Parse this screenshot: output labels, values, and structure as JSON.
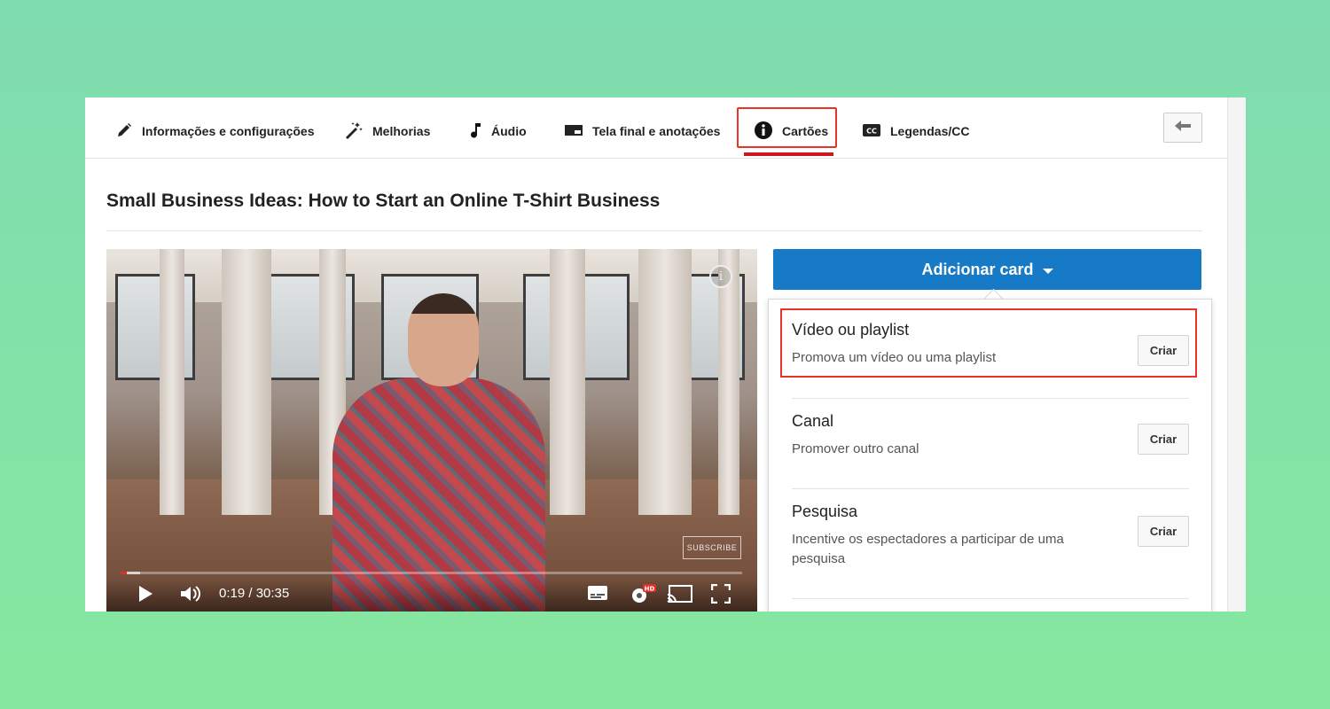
{
  "tabs": [
    {
      "label": "Informações e configurações",
      "icon": "pencil-icon"
    },
    {
      "label": "Melhorias",
      "icon": "magic-wand-icon"
    },
    {
      "label": "Áudio",
      "icon": "music-note-icon"
    },
    {
      "label": "Tela final e anotações",
      "icon": "end-screen-icon"
    },
    {
      "label": "Cartões",
      "icon": "info-icon"
    },
    {
      "label": "Legendas/CC",
      "icon": "cc-icon"
    }
  ],
  "active_tab": "Cartões",
  "video_title": "Small Business Ideas: How to Start an Online T-Shirt Business",
  "player": {
    "current_time": "0:19",
    "duration": "30:35",
    "time_display": "0:19 / 30:35",
    "progress_fraction": 0.0104,
    "subscribe_label": "SUBSCRIBE",
    "hd_badge": "HD"
  },
  "add_card_label": "Adicionar card",
  "card_options": [
    {
      "name": "Vídeo ou playlist",
      "description": "Promova um vídeo ou uma playlist",
      "button": "Criar"
    },
    {
      "name": "Canal",
      "description": "Promover outro canal",
      "button": "Criar"
    },
    {
      "name": "Pesquisa",
      "description": "Incentive os espectadores a participar de uma pesquisa",
      "button": "Criar"
    }
  ],
  "colors": {
    "accent_blue": "#167ac6",
    "highlight_red": "#e8332a",
    "background_green": "#80e0a8"
  }
}
